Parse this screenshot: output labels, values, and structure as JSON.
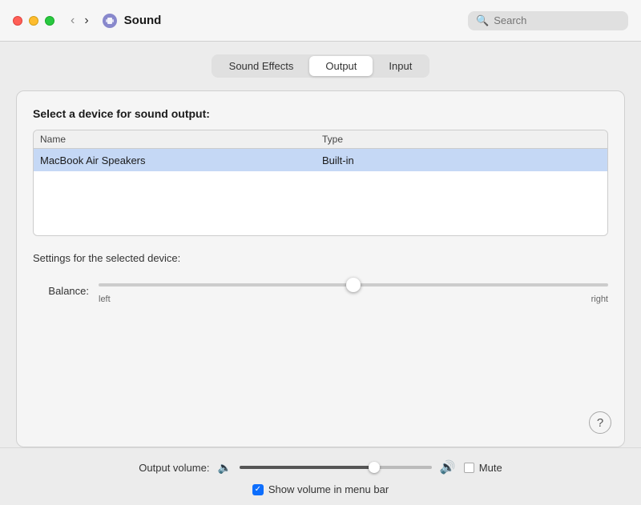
{
  "titlebar": {
    "title": "Sound",
    "search_placeholder": "Search"
  },
  "tabs": {
    "items": [
      {
        "id": "sound-effects",
        "label": "Sound Effects"
      },
      {
        "id": "output",
        "label": "Output",
        "active": true
      },
      {
        "id": "input",
        "label": "Input"
      }
    ]
  },
  "panel": {
    "section_title": "Select a device for sound output:",
    "table": {
      "headers": {
        "name": "Name",
        "type": "Type"
      },
      "rows": [
        {
          "name": "MacBook Air Speakers",
          "type": "Built-in"
        }
      ]
    },
    "settings_title": "Settings for the selected device:",
    "balance": {
      "label": "Balance:",
      "left_label": "left",
      "right_label": "right"
    },
    "help_label": "?"
  },
  "bottom_bar": {
    "volume_label": "Output volume:",
    "mute_label": "Mute",
    "show_volume_label": "Show volume in menu bar"
  }
}
